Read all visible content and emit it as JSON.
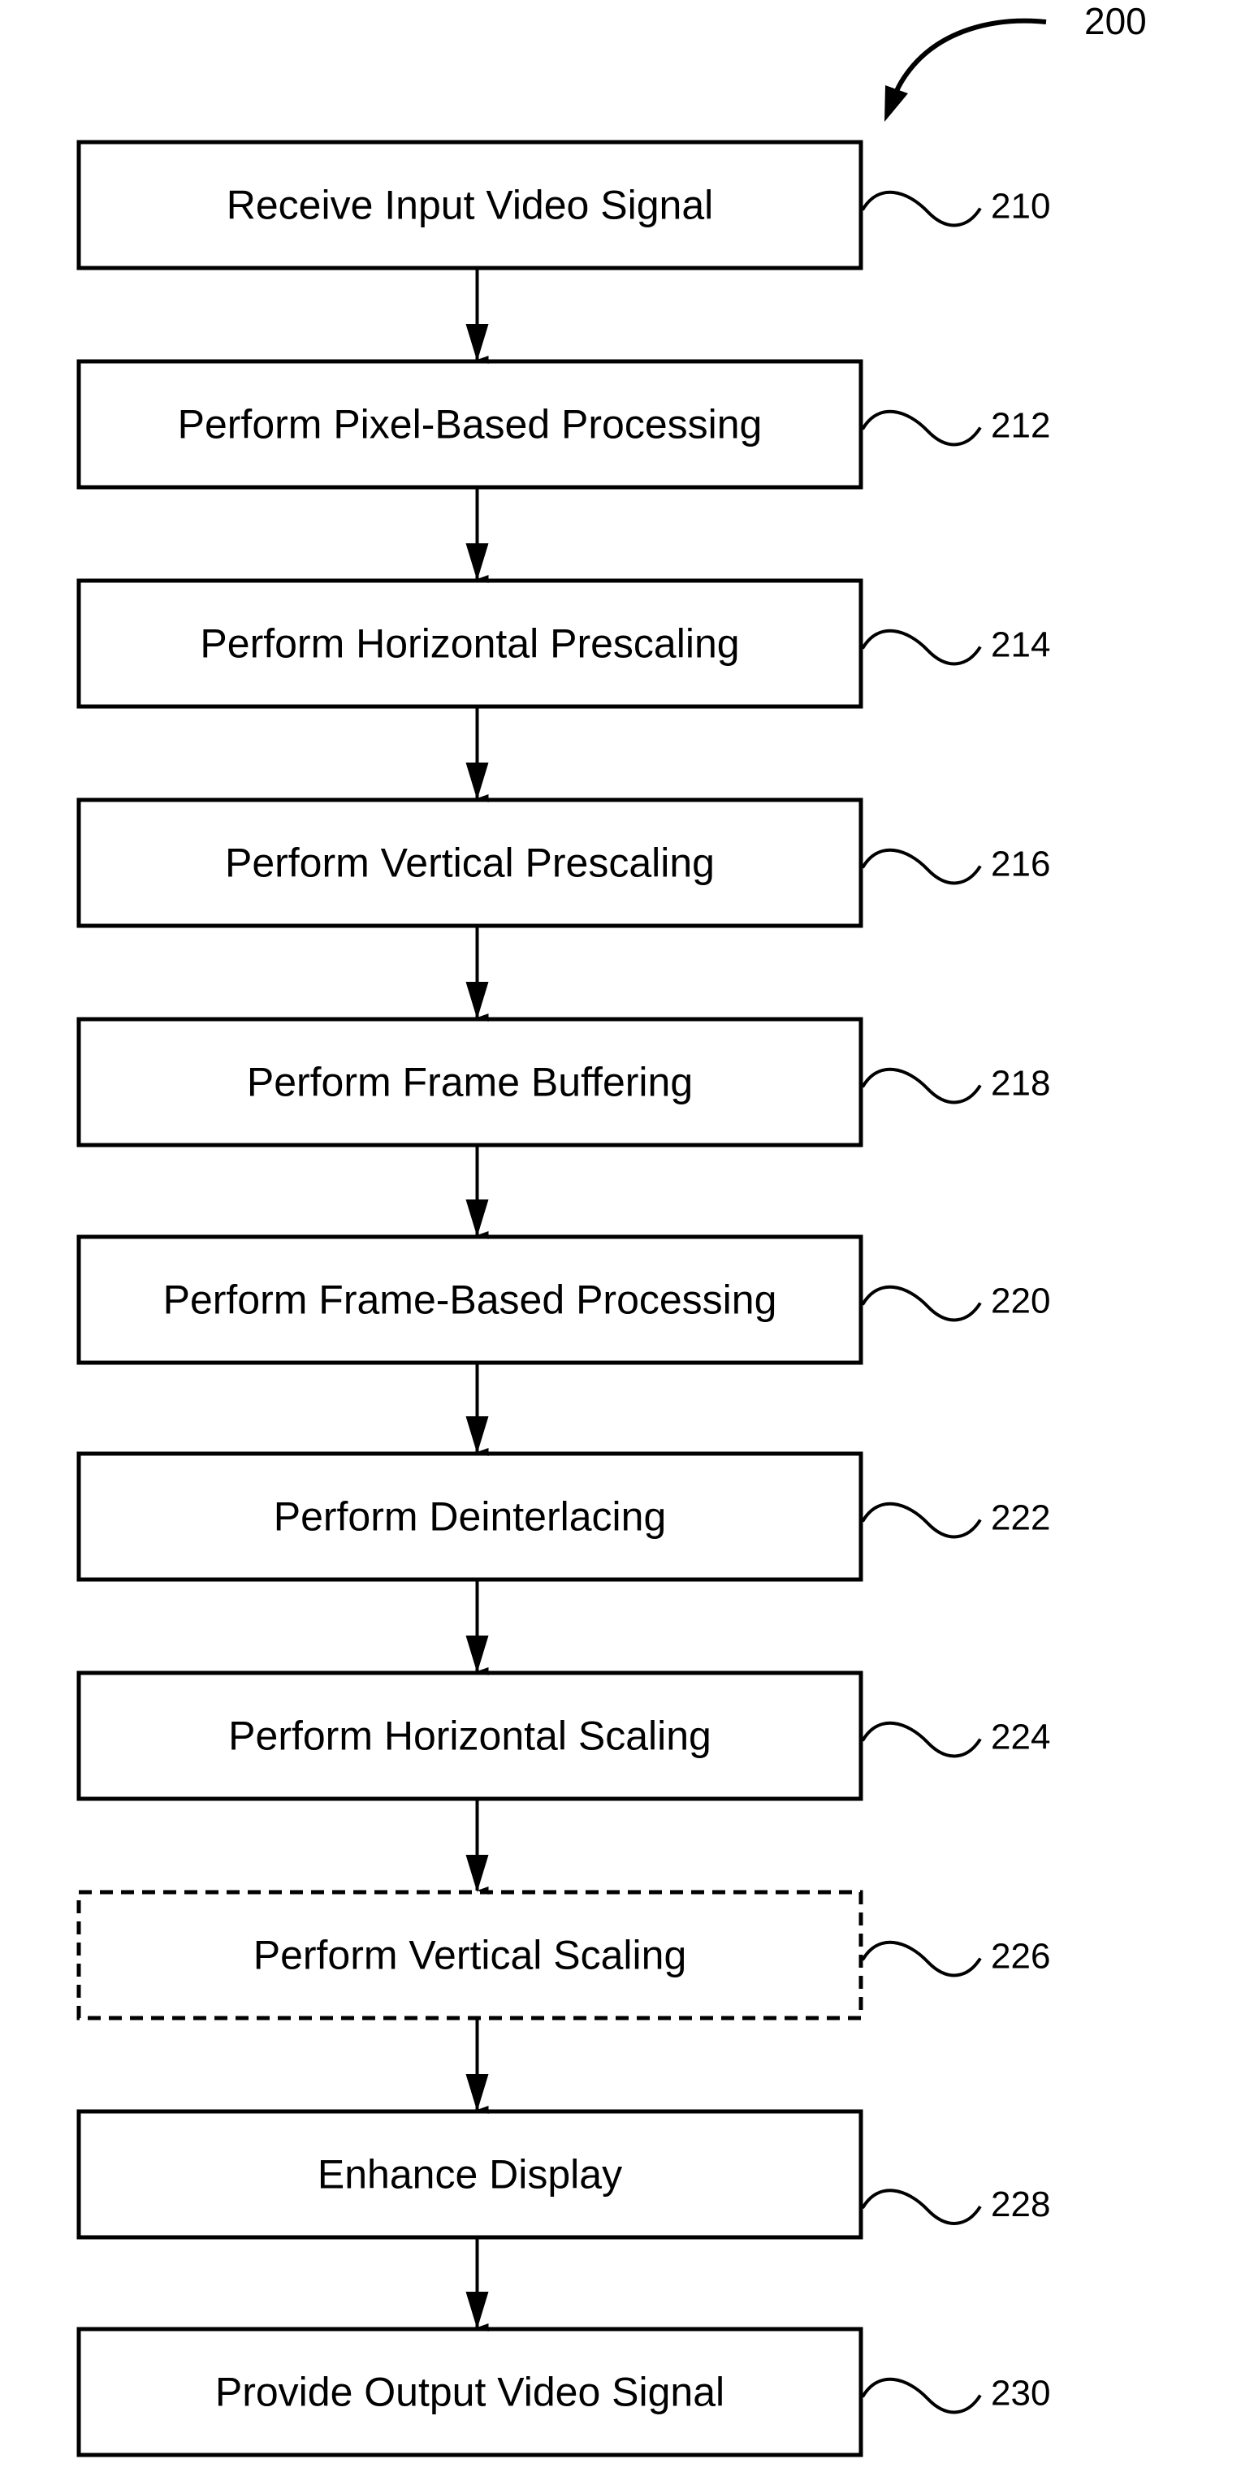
{
  "figure": {
    "reference": "200"
  },
  "steps": [
    {
      "ref": "210",
      "label": "Receive Input Video Signal",
      "optional": false
    },
    {
      "ref": "212",
      "label": "Perform Pixel-Based Processing",
      "optional": false
    },
    {
      "ref": "214",
      "label": "Perform Horizontal Prescaling",
      "optional": false
    },
    {
      "ref": "216",
      "label": "Perform Vertical Prescaling",
      "optional": false
    },
    {
      "ref": "218",
      "label": "Perform Frame Buffering",
      "optional": false
    },
    {
      "ref": "220",
      "label": "Perform Frame-Based Processing",
      "optional": false
    },
    {
      "ref": "222",
      "label": "Perform Deinterlacing",
      "optional": false
    },
    {
      "ref": "224",
      "label": "Perform Horizontal Scaling",
      "optional": false
    },
    {
      "ref": "226",
      "label": "Perform Vertical Scaling",
      "optional": true
    },
    {
      "ref": "228",
      "label": "Enhance Display",
      "optional": false
    },
    {
      "ref": "230",
      "label": "Provide Output Video Signal",
      "optional": false
    }
  ],
  "colors": {
    "stroke": "#000000",
    "background": "#ffffff"
  }
}
